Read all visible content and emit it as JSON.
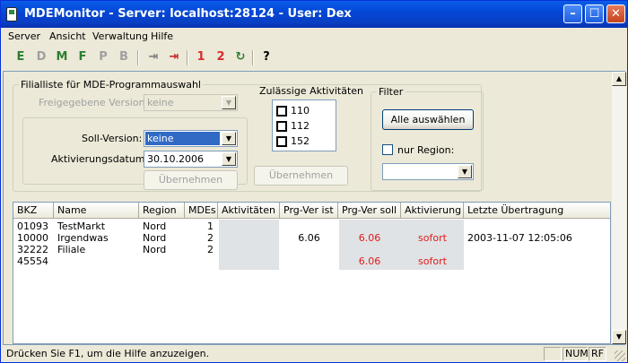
{
  "window": {
    "title": "MDEMonitor - Server: localhost:28124 - User: Dex"
  },
  "menu": [
    "Server",
    "Ansicht",
    "Verwaltung",
    "Hilfe"
  ],
  "toolbar": {
    "buttons": [
      {
        "icon": "E-icon",
        "glyph": "E",
        "color": "#2e7d32"
      },
      {
        "icon": "D-icon",
        "glyph": "D",
        "color": "#a0a0a0"
      },
      {
        "icon": "M-icon",
        "glyph": "M",
        "color": "#2e7d32"
      },
      {
        "icon": "F-icon",
        "glyph": "F",
        "color": "#2e7d32"
      },
      {
        "icon": "P-icon",
        "glyph": "P",
        "color": "#a0a0a0"
      },
      {
        "icon": "B-icon",
        "glyph": "B",
        "color": "#a0a0a0"
      },
      {
        "icon": "import-icon",
        "glyph": "⇥",
        "color": "#808080"
      },
      {
        "icon": "export-icon",
        "glyph": "⇥",
        "color": "#c62828"
      },
      {
        "icon": "one-icon",
        "glyph": "1",
        "color": "#d32f2f"
      },
      {
        "icon": "two-icon",
        "glyph": "2",
        "color": "#d32f2f"
      },
      {
        "icon": "refresh-icon",
        "glyph": "↻",
        "color": "#2e7d32"
      },
      {
        "icon": "help-icon",
        "glyph": "?",
        "color": "#000000"
      }
    ]
  },
  "filialliste": {
    "title": "Filialliste für MDE-Programmauswahl",
    "freigegeben_label": "Freigegebene Version:",
    "freigegeben_value": "keine",
    "soll_label": "Soll-Version:",
    "soll_value": "keine",
    "datum_label": "Aktivierungsdatum:",
    "datum_value": "30.10.2006",
    "uebernehmen": "Übernehmen"
  },
  "aktivitaeten": {
    "title": "Zulässige Aktivitäten",
    "items": [
      "110",
      "112",
      "152"
    ],
    "uebernehmen": "Übernehmen"
  },
  "filter": {
    "title": "Filter",
    "alle_button": "Alle auswählen",
    "nur_region_label": "nur Region:",
    "region_value": ""
  },
  "table": {
    "columns": [
      "BKZ",
      "Name",
      "Region",
      "MDEs",
      "Aktivitäten",
      "Prg-Ver ist",
      "Prg-Ver soll",
      "Aktivierung",
      "Letzte Übertragung"
    ],
    "rows": [
      {
        "bkz": "01093",
        "name": "TestMarkt",
        "region": "Nord",
        "mdes": "1",
        "aktivitaeten": "",
        "ist": "",
        "soll": "",
        "aktivierung": "",
        "letzte": ""
      },
      {
        "bkz": "10000",
        "name": "Irgendwas",
        "region": "Nord",
        "mdes": "2",
        "aktivitaeten": "",
        "ist": "6.06",
        "soll": "6.06",
        "aktivierung": "sofort",
        "letzte": "2003-11-07 12:05:06"
      },
      {
        "bkz": "32222",
        "name": "Filiale",
        "region": "Nord",
        "mdes": "2",
        "aktivitaeten": "",
        "ist": "",
        "soll": "",
        "aktivierung": "",
        "letzte": ""
      },
      {
        "bkz": "45554",
        "name": "",
        "region": "",
        "mdes": "",
        "aktivitaeten": "",
        "ist": "",
        "soll": "6.06",
        "aktivierung": "sofort",
        "letzte": ""
      }
    ]
  },
  "status": {
    "text": "Drücken Sie F1, um die Hilfe anzuzeigen.",
    "num": "NUM",
    "rf": "RF"
  },
  "colors": {
    "titlebar": "#0a5de8",
    "highlight_red": "#e21b1b",
    "shaded_cells": "#dfe3e5"
  }
}
